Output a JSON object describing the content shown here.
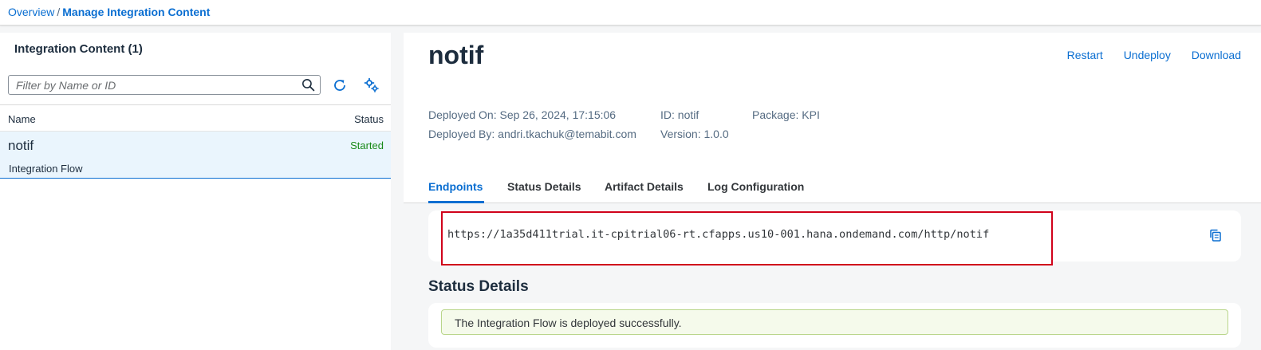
{
  "breadcrumb": {
    "overview": "Overview",
    "separator": "/",
    "current": "Manage Integration Content"
  },
  "sidebar": {
    "title": "Integration Content (1)",
    "filter_placeholder": "Filter by Name or ID",
    "columns": {
      "name": "Name",
      "status": "Status"
    },
    "items": [
      {
        "name": "notif",
        "status": "Started",
        "type": "Integration Flow"
      }
    ]
  },
  "detail": {
    "title": "notif",
    "actions": {
      "restart": "Restart",
      "undeploy": "Undeploy",
      "download": "Download"
    },
    "deployed_on": "Deployed On: Sep 26, 2024, 17:15:06",
    "deployed_by": "Deployed By: andri.tkachuk@temabit.com",
    "id": "ID: notif",
    "version": "Version: 1.0.0",
    "package": "Package: KPI",
    "tabs": [
      "Endpoints",
      "Status Details",
      "Artifact Details",
      "Log Configuration"
    ],
    "active_tab": "Endpoints",
    "endpoint_url": "https://1a35d411trial.it-cpitrial06-rt.cfapps.us10-001.hana.ondemand.com/http/notif",
    "status_section_title": "Status Details",
    "status_message": "The Integration Flow is deployed successfully."
  },
  "icons": {
    "search": "search-icon",
    "refresh": "refresh-icon",
    "settings": "settings-icon",
    "copy": "copy-icon"
  },
  "colors": {
    "accent": "#0a6ed1",
    "status_started": "#188918",
    "highlight_box": "#d0021b",
    "success_strip": "#f5faeb"
  }
}
